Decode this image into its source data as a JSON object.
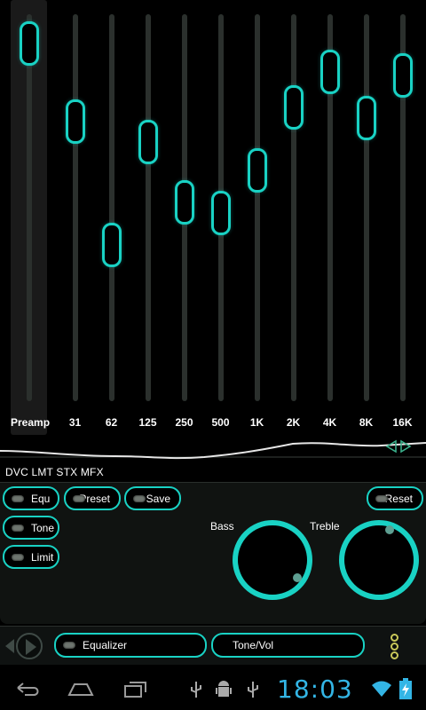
{
  "equalizer": {
    "bands": [
      {
        "label": "Preamp",
        "level": 0.97
      },
      {
        "label": "31",
        "level": 0.75
      },
      {
        "label": "62",
        "level": 0.4
      },
      {
        "label": "125",
        "level": 0.69
      },
      {
        "label": "250",
        "level": 0.52
      },
      {
        "label": "500",
        "level": 0.49
      },
      {
        "label": "1K",
        "level": 0.61
      },
      {
        "label": "2K",
        "level": 0.79
      },
      {
        "label": "4K",
        "level": 0.89
      },
      {
        "label": "8K",
        "level": 0.76
      },
      {
        "label": "16K",
        "level": 0.88
      }
    ]
  },
  "effects": {
    "line": "DVC LMT STX MFX"
  },
  "controls": {
    "equ_label": "Equ",
    "tone_label": "Tone",
    "limit_label": "Limit",
    "preset_label": "Preset",
    "save_label": "Save",
    "reset_label": "Reset",
    "bass_label": "Bass",
    "treble_label": "Treble"
  },
  "bottom_nav": {
    "equalizer_label": "Equalizer",
    "tone_vol_label": "Tone/Vol"
  },
  "status_bar": {
    "time": "18:03"
  },
  "colors": {
    "accent": "#19d2c4",
    "clock": "#33b5e5",
    "led_off": "#6e756f"
  }
}
